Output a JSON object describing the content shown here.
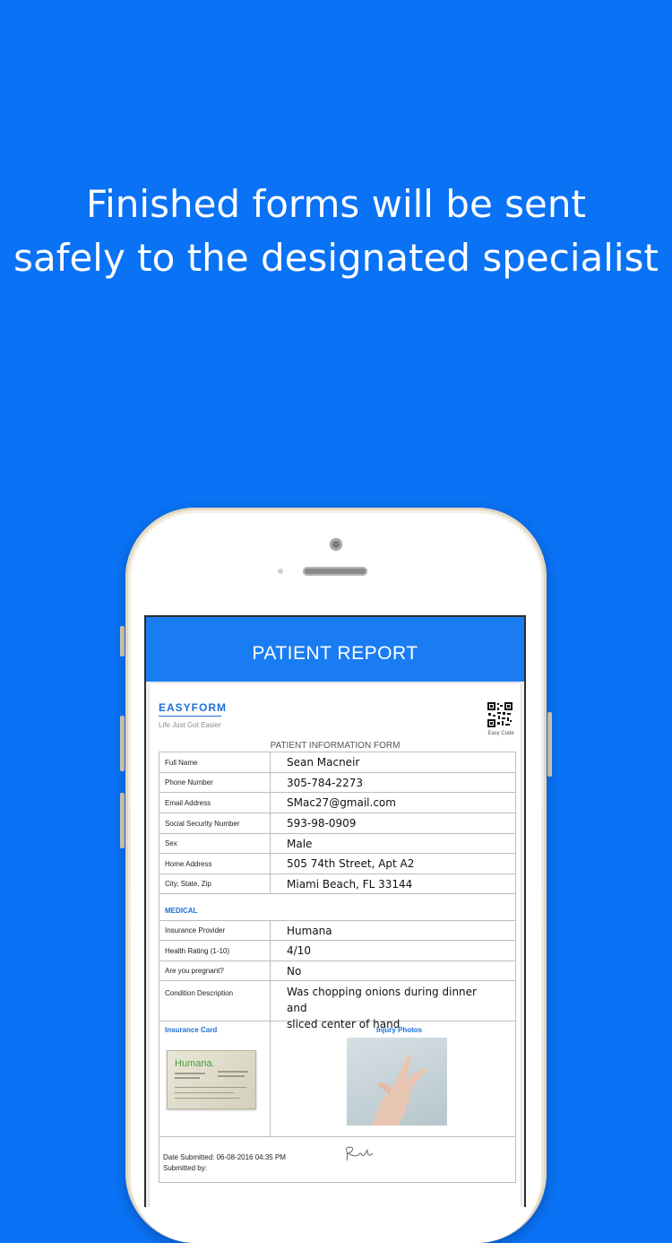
{
  "headline": {
    "line1": "Finished forms will be sent",
    "line2": "safely to the designated specialist"
  },
  "app": {
    "title": "PATIENT REPORT"
  },
  "form": {
    "brand": "EASYFORM",
    "tagline": "Life Just Got Easier",
    "qr_caption": "Easy Code",
    "title": "PATIENT INFORMATION FORM",
    "personal": [
      {
        "label": "Full Name",
        "value": "Sean Macneir"
      },
      {
        "label": "Phone Number",
        "value": "305-784-2273"
      },
      {
        "label": "Email Address",
        "value": "SMac27@gmail.com"
      },
      {
        "label": "Social Security Number",
        "value": "593-98-0909"
      },
      {
        "label": "Sex",
        "value": "Male"
      },
      {
        "label": "Home Address",
        "value": "505 74th Street, Apt A2"
      },
      {
        "label": "City, State, Zip",
        "value": "Miami Beach, FL 33144"
      }
    ],
    "medical_heading": "MEDICAL",
    "medical": [
      {
        "label": "Insurance Provider",
        "value": "Humana"
      },
      {
        "label": "Health Rating (1-10)",
        "value": "4/10"
      },
      {
        "label": "Are you pregnant?",
        "value": "No"
      },
      {
        "label": "Condition Description",
        "value_line1": "Was chopping onions during dinner and",
        "value_line2": "sliced center of hand"
      }
    ],
    "insurance_card_label": "Insurance Card",
    "insurance_card_logo": "Humana.",
    "injury_photos_label": "Injury Photos",
    "date_submitted": "Date Submitted: 06-08-2016 04:35 PM",
    "submitted_by": "Submitted by:"
  }
}
